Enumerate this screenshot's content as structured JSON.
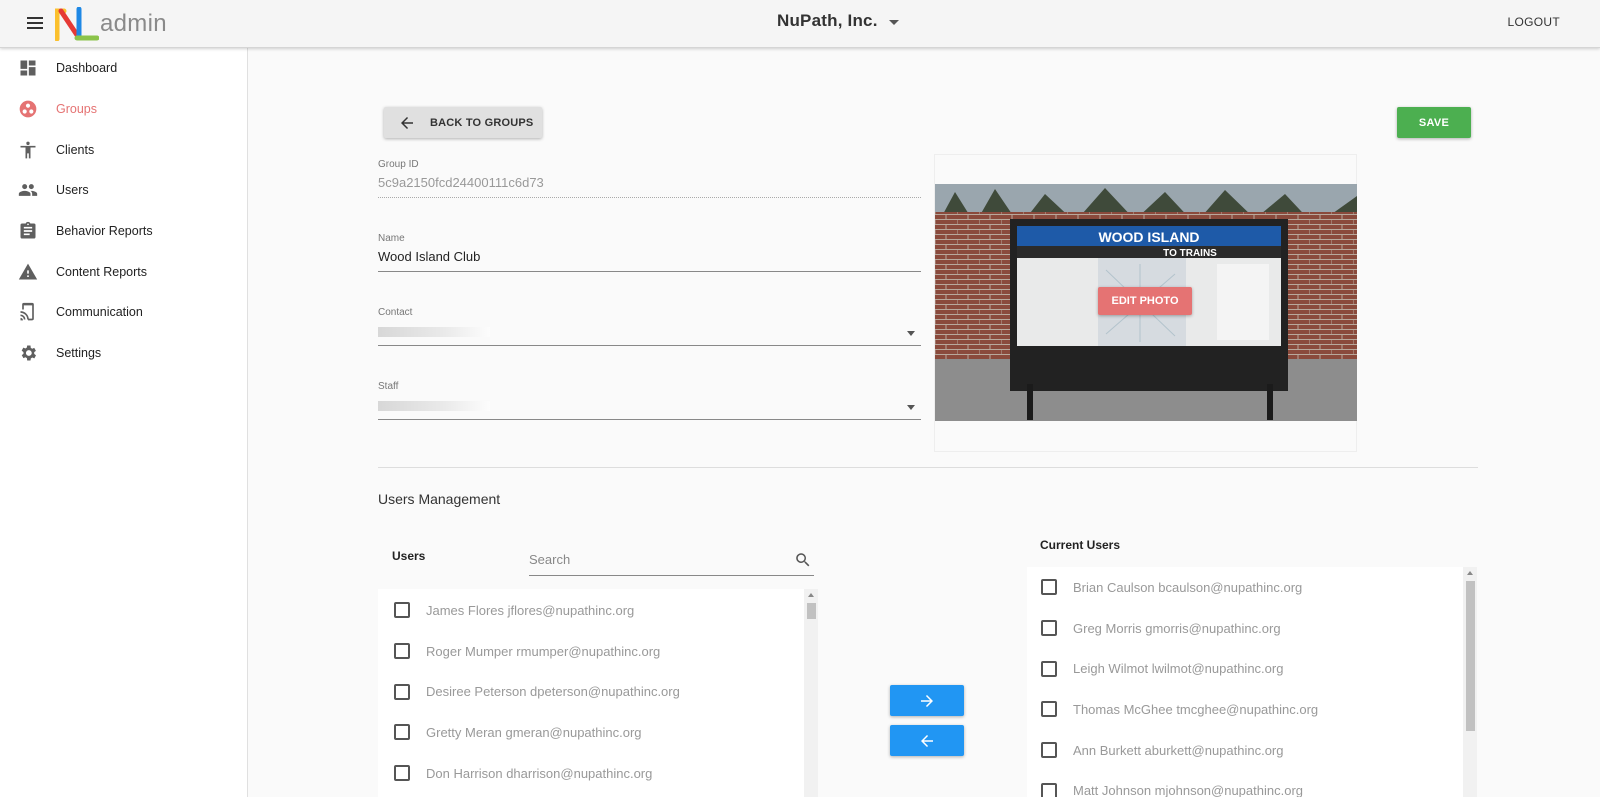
{
  "header": {
    "logo_letter": "N",
    "logo_text": "admin",
    "org_name": "NuPath, Inc.",
    "logout_label": "LOGOUT"
  },
  "sidebar": {
    "items": [
      {
        "label": "Dashboard",
        "icon": "dashboard-icon",
        "active": false
      },
      {
        "label": "Groups",
        "icon": "groups-icon",
        "active": true
      },
      {
        "label": "Clients",
        "icon": "accessibility-icon",
        "active": false
      },
      {
        "label": "Users",
        "icon": "people-icon",
        "active": false
      },
      {
        "label": "Behavior Reports",
        "icon": "clipboard-icon",
        "active": false
      },
      {
        "label": "Content Reports",
        "icon": "warning-icon",
        "active": false
      },
      {
        "label": "Communication",
        "icon": "cast-icon",
        "active": false
      },
      {
        "label": "Settings",
        "icon": "gear-icon",
        "active": false
      }
    ],
    "active_color": "#e57373"
  },
  "toolbar": {
    "back_label": "BACK TO GROUPS",
    "save_label": "SAVE",
    "save_color": "#4caf50"
  },
  "form": {
    "group_id_label": "Group ID",
    "group_id_value": "5c9a2150fcd24400111c6d73",
    "name_label": "Name",
    "name_value": "Wood Island Club",
    "contact_label": "Contact",
    "contact_value": "",
    "staff_label": "Staff",
    "staff_value": ""
  },
  "photo": {
    "edit_label": "EDIT PHOTO",
    "sign_title": "WOOD ISLAND",
    "sign_subtitle": "TO TRAINS"
  },
  "users_management": {
    "title": "Users Management",
    "users_title": "Users",
    "search_placeholder": "Search",
    "current_users_title": "Current Users",
    "available_users": [
      "James Flores jflores@nupathinc.org",
      "Roger Mumper rmumper@nupathinc.org",
      "Desiree Peterson dpeterson@nupathinc.org",
      "Gretty Meran gmeran@nupathinc.org",
      "Don Harrison dharrison@nupathinc.org"
    ],
    "current_users": [
      "Brian Caulson bcaulson@nupathinc.org",
      "Greg Morris gmorris@nupathinc.org",
      "Leigh Wilmot lwilmot@nupathinc.org",
      "Thomas McGhee tmcghee@nupathinc.org",
      "Ann Burkett aburkett@nupathinc.org",
      "Matt Johnson mjohnson@nupathinc.org"
    ],
    "action_color": "#2196f3"
  }
}
